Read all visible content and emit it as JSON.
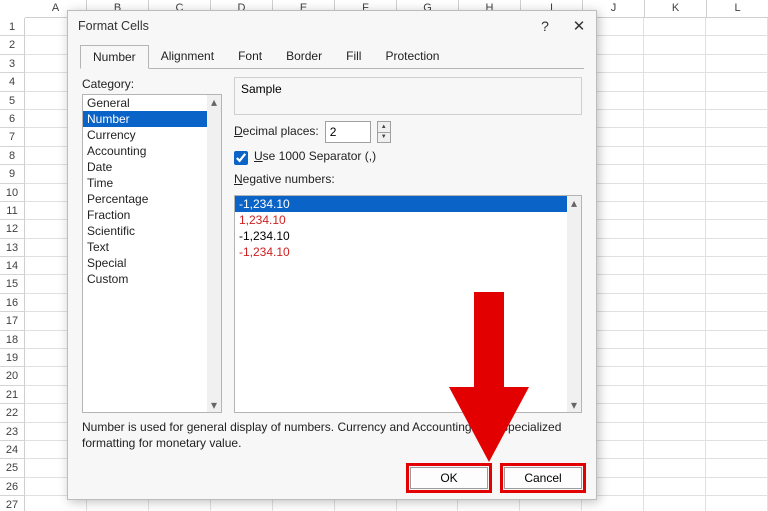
{
  "spreadsheet": {
    "columns": [
      "A",
      "B",
      "C",
      "D",
      "E",
      "F",
      "G",
      "H",
      "I",
      "J",
      "K",
      "L"
    ],
    "row_count": 27
  },
  "dialog": {
    "title": "Format Cells",
    "tabs": [
      "Number",
      "Alignment",
      "Font",
      "Border",
      "Fill",
      "Protection"
    ],
    "active_tab": "Number",
    "category_label": "Category:",
    "categories": [
      "General",
      "Number",
      "Currency",
      "Accounting",
      "Date",
      "Time",
      "Percentage",
      "Fraction",
      "Scientific",
      "Text",
      "Special",
      "Custom"
    ],
    "selected_category": "Number",
    "sample_label": "Sample",
    "decimal_label_pre": "D",
    "decimal_label_rest": "ecimal places:",
    "decimal_value": "2",
    "separator_label_pre": "U",
    "separator_label_rest": "se 1000 Separator (,)",
    "separator_checked": true,
    "negative_label_pre": "N",
    "negative_label_rest": "egative numbers:",
    "negative_options": [
      {
        "text": "-1,234.10",
        "red": false,
        "selected": true
      },
      {
        "text": "1,234.10",
        "red": true,
        "selected": false
      },
      {
        "text": "-1,234.10",
        "red": false,
        "selected": false
      },
      {
        "text": "-1,234.10",
        "red": true,
        "selected": false
      }
    ],
    "help_text": "Number is used for general display of numbers.  Currency and Accounting offer specialized formatting for monetary value.",
    "ok_label": "OK",
    "cancel_label": "Cancel"
  },
  "annotations": {
    "arrow_color": "#e30000"
  }
}
